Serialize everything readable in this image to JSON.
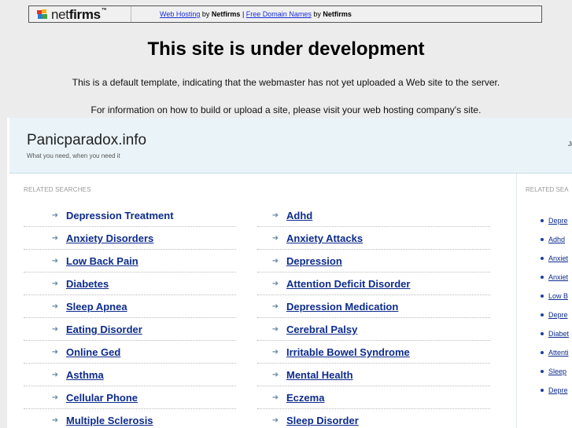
{
  "netfirms_bar": {
    "logo_net": "net",
    "logo_firms": "firms",
    "logo_tm": "™",
    "link_web_hosting": "Web Hosting",
    "by1": "by",
    "brand1": "Netfirms",
    "sep": "|",
    "link_free_domain": "Free Domain Names",
    "by2": "by",
    "brand2": "Netfirms"
  },
  "page": {
    "title": "This site is under development",
    "message1": "This is a default template, indicating that the webmaster has not yet uploaded a Web site to the server.",
    "message2": "For information on how to build or upload a site, please visit your web hosting company's site."
  },
  "parked": {
    "site_name": "Panicparadox.info",
    "tagline": "What you need, when you need it",
    "header_right": "Ju",
    "related_label": "RELATED SEARCHES",
    "left_list": [
      "Depression Treatment",
      "Anxiety Disorders",
      "Low Back Pain",
      "Diabetes",
      "Sleep Apnea",
      "Eating Disorder",
      "Online Ged",
      "Asthma",
      "Cellular Phone",
      "Multiple Sclerosis"
    ],
    "right_list": [
      "Adhd",
      "Anxiety Attacks",
      "Depression",
      "Attention Deficit Disorder",
      "Depression Medication",
      "Cerebral Palsy",
      "Irritable Bowel Syndrome",
      "Mental Health",
      "Eczema",
      "Sleep Disorder"
    ],
    "side_label": "RELATED SEA",
    "side_list": [
      "Depre",
      "Adhd",
      "Anxiet",
      "Anxiet",
      "Low B",
      "Depre",
      "Diabet",
      "Attenti",
      "Sleep",
      "Depre"
    ],
    "arrow_glyph": "➜"
  },
  "colors": {
    "link": "#0d2b8c",
    "header_bg": "#eaf4f8",
    "page_bg": "#ececec"
  }
}
